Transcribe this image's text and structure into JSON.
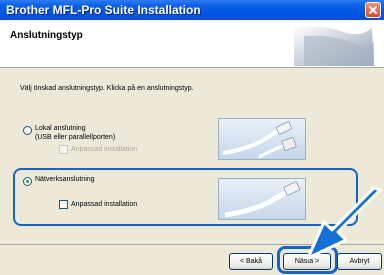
{
  "window": {
    "title": "Brother MFL-Pro Suite Installation"
  },
  "header": {
    "title": "Anslutningstyp"
  },
  "instruction": "Välj önskad anslutningstyp. Klicka på en anslutningstyp.",
  "options": {
    "local": {
      "label": "Lokal anslutning",
      "sublabel": "(USB eller parallellporten)",
      "checkbox_label": "Anpassad installation",
      "selected": false,
      "checkbox_enabled": false
    },
    "network": {
      "label": "Nätverksanslutning",
      "checkbox_label": "Anpassad installation",
      "selected": true,
      "checkbox_enabled": true
    }
  },
  "buttons": {
    "back_label": "< Bakå",
    "next_label": "Nästa >",
    "cancel_label": "Avbryt"
  },
  "icons": {
    "close": "close-icon",
    "arrow": "pointer-arrow-icon"
  },
  "colors": {
    "highlight": "#1565c8",
    "titlebar": "#0054e3"
  }
}
